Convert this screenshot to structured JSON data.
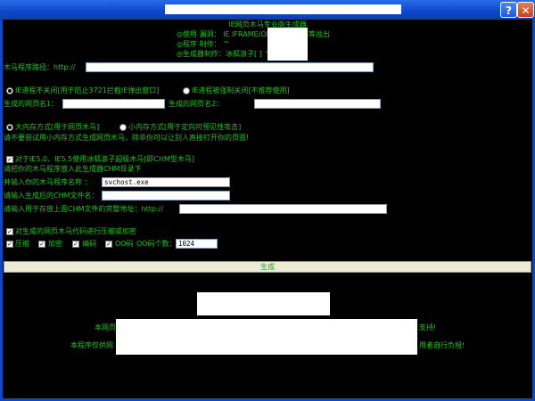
{
  "window": {
    "title": "",
    "help_glyph": "?",
    "close_glyph": "✕"
  },
  "header": {
    "line1": "IE网页木马专业版生成器",
    "line2": "◎使用  漏洞：    IE IFRAME/OBJECT/CHM 等溢出",
    "line3": "◎程序  制作：                              ™",
    "line4": "◎生成器制作：冰狐浪子[                    ]    ™"
  },
  "trojan_path": {
    "label": "木马程序路径：http://",
    "value": ""
  },
  "ie_mode": {
    "option1": "IE进程不关闭[用于防止3721拦截IE弹出窗口]",
    "option2": "IE进程被强制关闭[不推荐使用]",
    "selected": 0
  },
  "page_names": {
    "name1_label": "生成的网页名1：",
    "name1_value": "",
    "name2_label": "生成的网页名2：",
    "name2_value": ""
  },
  "memory_mode": {
    "option1": "大内存方式[用于网页木马]",
    "option2": "小内存方式[用于定向可预见性攻击]",
    "selected": 0,
    "note": "请不要尝试用小内存方式生成网页木马，除非你可以让别人直接打开你的页面!"
  },
  "chm": {
    "checkbox_label": "对于IE5.0、IE5.5使用冰狐浪子超级木马[即CHM型木马]",
    "checked": true,
    "note": "请把你的木马程序放入此生成器CHM目录下",
    "program_label": "并输入你的木马程序名称 ：",
    "program_value": "svchost.exe",
    "chm_name_label": "请输入生成后的CHM文件名：",
    "chm_name_value": "",
    "url_label": "请输入用于存放上面CHM文件的完整地址：http://",
    "url_value": ""
  },
  "encode": {
    "checkbox_label": "对生成的网页木马代码进行压缩或加密",
    "checked": true,
    "compress_label": "压缩",
    "encrypt_label": "加密",
    "encode_label": "编码",
    "oo_label": "OO码",
    "oo_count_label": "OO码个数：",
    "oo_count_value": "1024"
  },
  "generate_button": "生成",
  "footer": {
    "line1": "本网页",
    "line1_end": "支持!",
    "line2": "本程序仅供网",
    "line2_end": "用者自行负担!"
  }
}
